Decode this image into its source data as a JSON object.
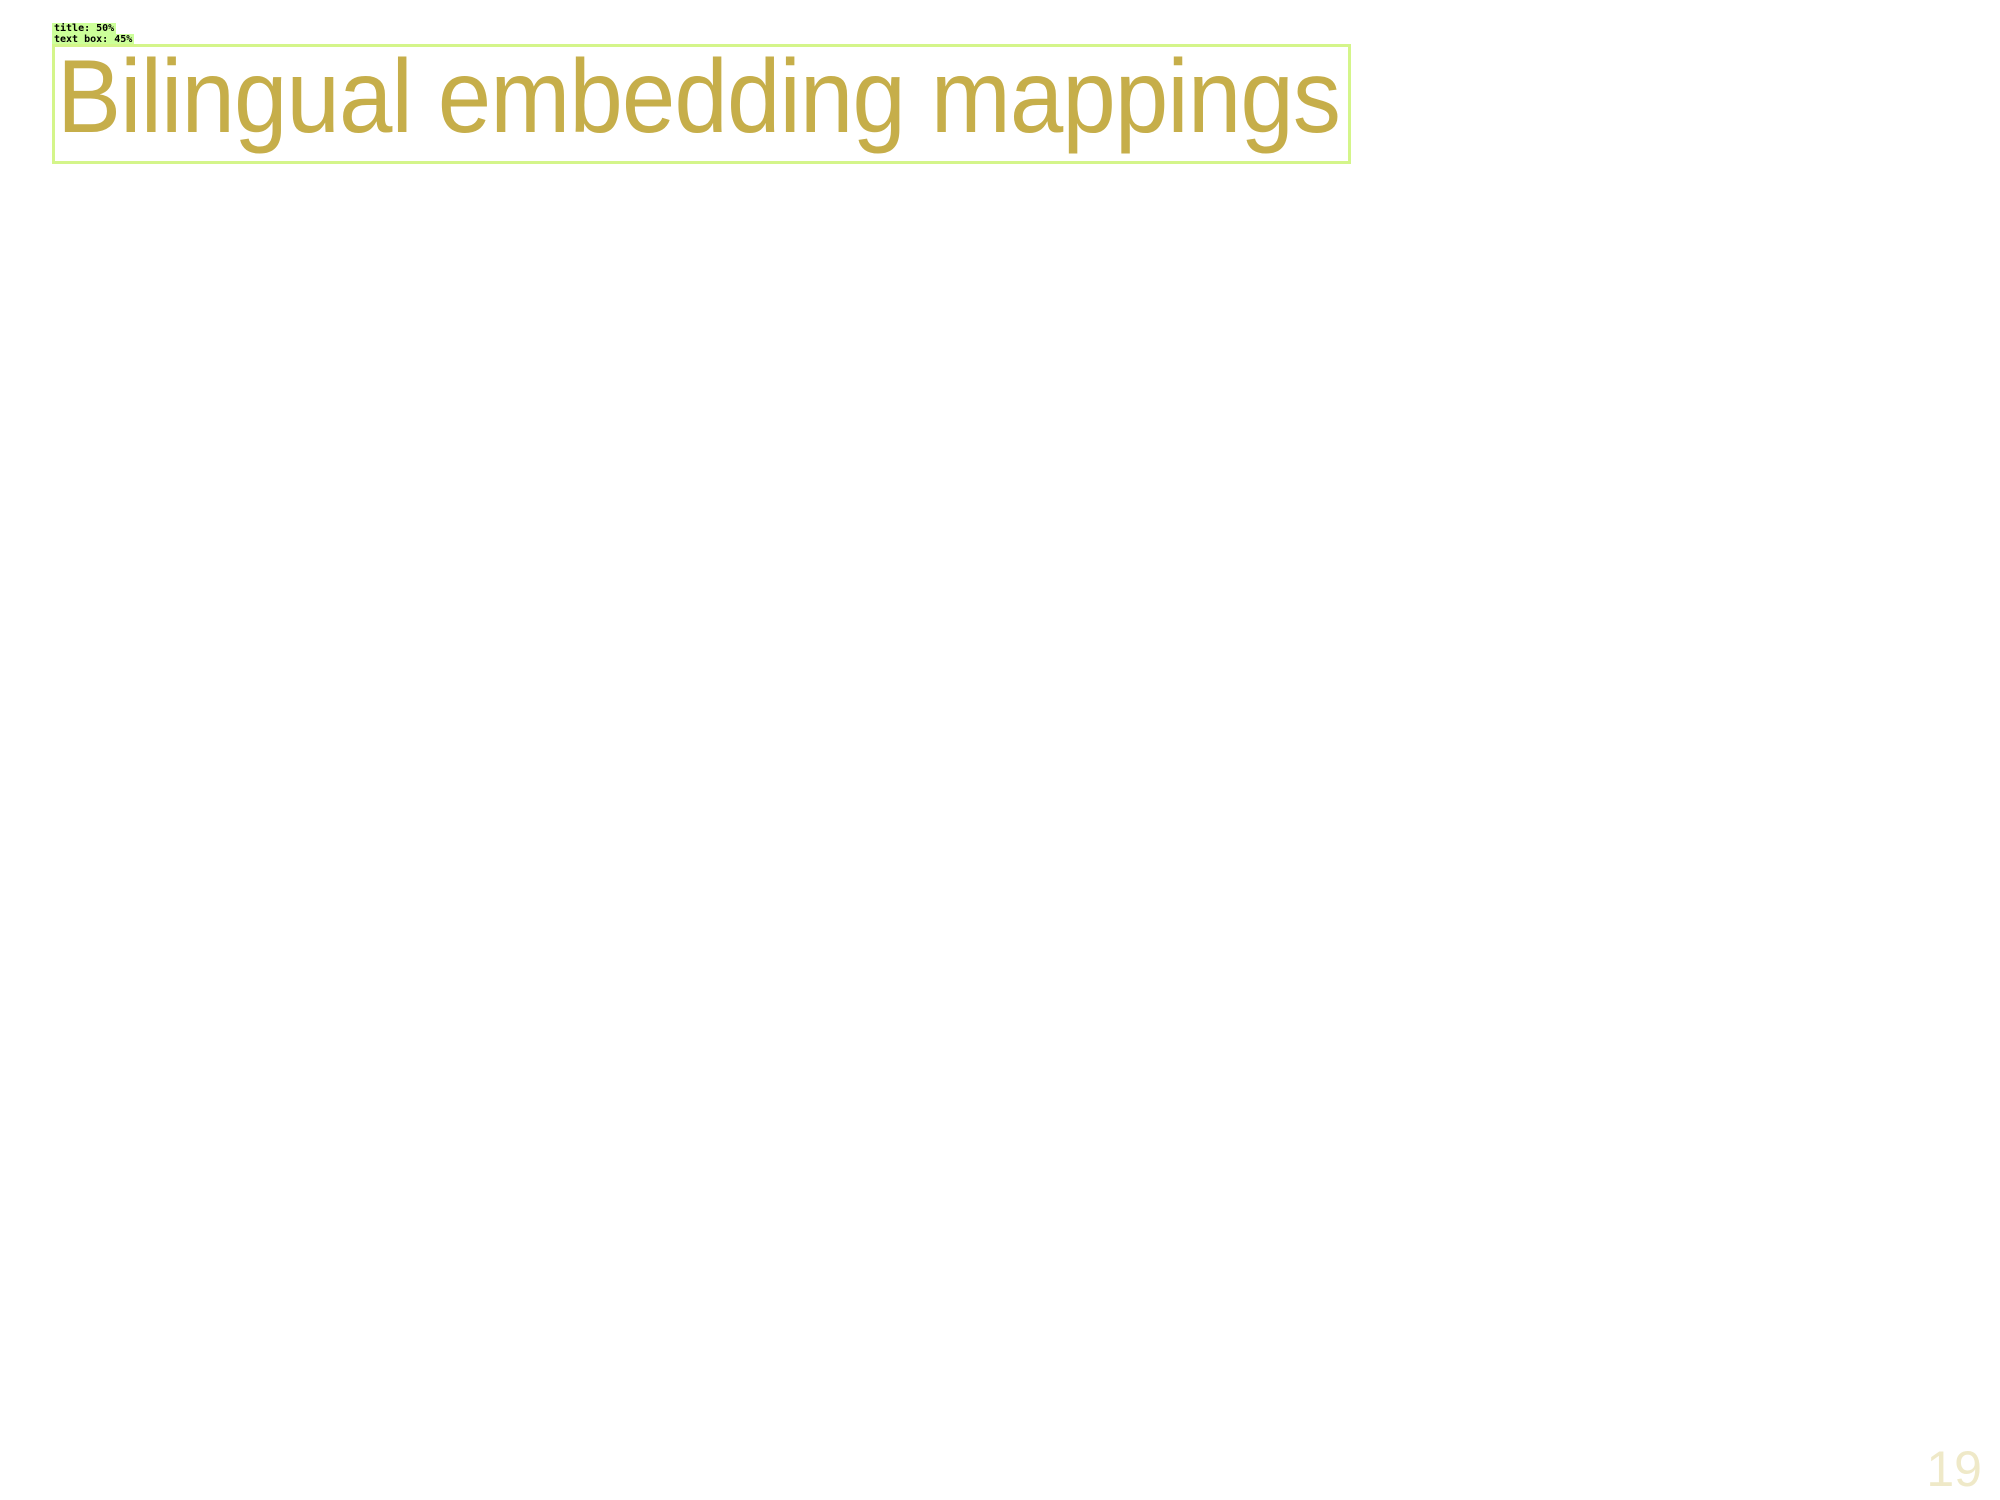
{
  "overlay_labels": {
    "title_label": "title: 50%",
    "text_box_label": "text box: 45%"
  },
  "slide": {
    "title": "Bilingual embedding mappings",
    "page_number": "19",
    "title_color": "#c6ae4a",
    "box_color": "#d4f58a"
  }
}
